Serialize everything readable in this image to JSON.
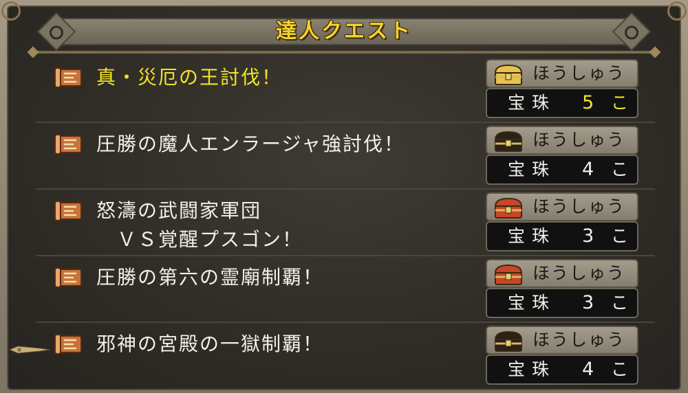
{
  "header": {
    "title": "達人クエスト"
  },
  "quests": [
    {
      "name": "真・災厄の王討伐！",
      "highlighted": true,
      "chest": "gold",
      "reward_label": "ほうしゅう",
      "reward_item": "宝珠",
      "reward_qty": "5",
      "reward_unit": "こ"
    },
    {
      "name": "圧勝の魔人エンラージャ強討伐！",
      "highlighted": false,
      "chest": "black",
      "reward_label": "ほうしゅう",
      "reward_item": "宝珠",
      "reward_qty": "4",
      "reward_unit": "こ"
    },
    {
      "name": "怒濤の武闘家軍団\n　ＶＳ覚醒プスゴン！",
      "highlighted": false,
      "chest": "red",
      "reward_label": "ほうしゅう",
      "reward_item": "宝珠",
      "reward_qty": "3",
      "reward_unit": "こ"
    },
    {
      "name": "圧勝の第六の霊廟制覇！",
      "highlighted": false,
      "chest": "red",
      "reward_label": "ほうしゅう",
      "reward_item": "宝珠",
      "reward_qty": "3",
      "reward_unit": "こ"
    },
    {
      "name": "邪神の宮殿の一獄制覇！",
      "highlighted": false,
      "chest": "black",
      "reward_label": "ほうしゅう",
      "reward_item": "宝珠",
      "reward_qty": "4",
      "reward_unit": "こ"
    }
  ],
  "colors": {
    "highlight": "#f2e22a",
    "text": "#f2f0ea",
    "chest_gold": "#e8c24a",
    "chest_black": "#2a2218",
    "chest_red": "#c8452a"
  }
}
